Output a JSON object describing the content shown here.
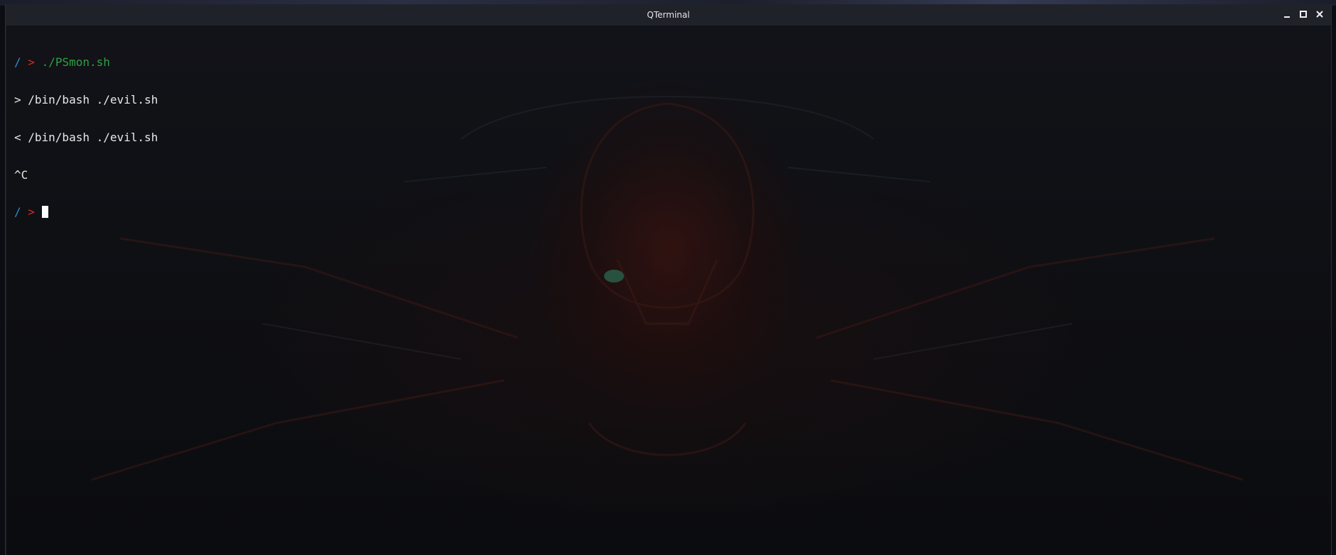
{
  "window": {
    "title": "QTerminal",
    "controls": {
      "minimize_icon": "minimize-icon",
      "maximize_icon": "maximize-icon",
      "close_icon": "close-icon"
    }
  },
  "terminal": {
    "prompt_path": "/",
    "prompt_arrow": ">",
    "lines": [
      {
        "type": "prompt",
        "command": "./PSmon.sh"
      },
      {
        "type": "output",
        "text": "> /bin/bash ./evil.sh"
      },
      {
        "type": "output",
        "text": "< /bin/bash ./evil.sh"
      },
      {
        "type": "output",
        "text": "^C"
      },
      {
        "type": "prompt",
        "command": ""
      }
    ]
  },
  "colors": {
    "prompt_path": "#2f8ccf",
    "prompt_arrow": "#e0281e",
    "command": "#2ea043",
    "output": "#e8e8e8",
    "titlebar": "#20222a"
  }
}
